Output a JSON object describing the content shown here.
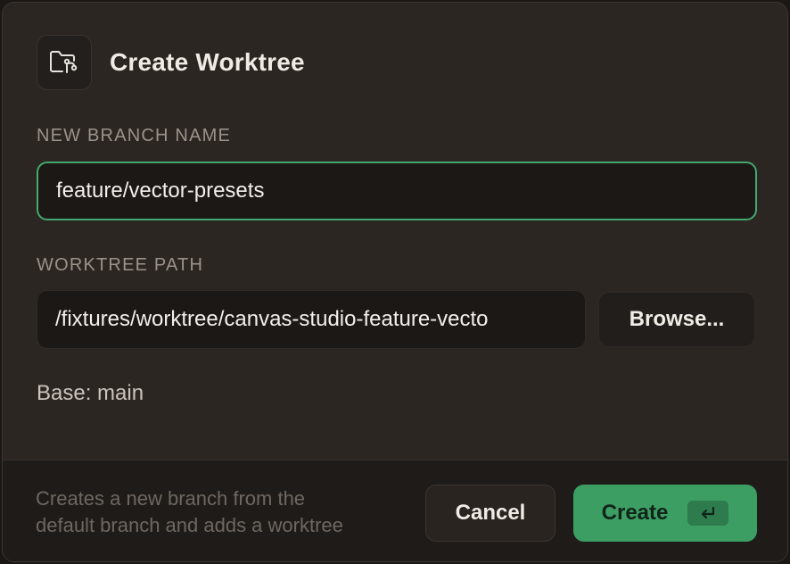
{
  "dialog": {
    "title": "Create Worktree",
    "icon": "folder-branch-icon"
  },
  "branch": {
    "label": "NEW BRANCH NAME",
    "value": "feature/vector-presets"
  },
  "path": {
    "label": "WORKTREE PATH",
    "value": "/fixtures/worktree/canvas-studio-feature-vecto",
    "browse_label": "Browse..."
  },
  "base_text": "Base: main",
  "footer": {
    "hint_line1": "Creates a new branch from the",
    "hint_line2": "default branch and adds a worktree",
    "cancel_label": "Cancel",
    "create_label": "Create",
    "enter_icon": "return-key-icon"
  },
  "colors": {
    "accent": "#3c9e63",
    "focus_border": "#45a86e",
    "dialog_bg": "#2c2622",
    "footer_bg": "#1f1b18"
  }
}
